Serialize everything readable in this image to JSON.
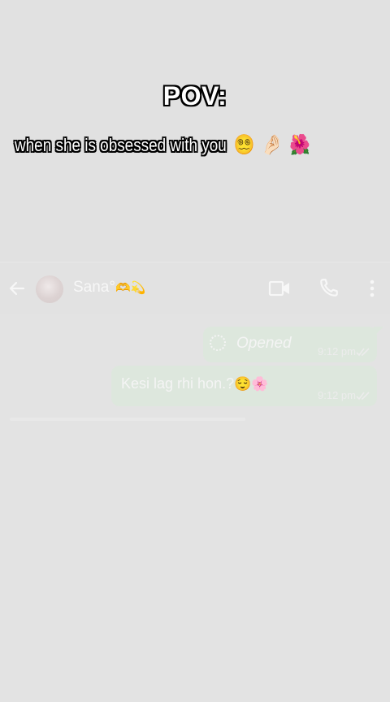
{
  "overlay": {
    "title": "POV:",
    "line_text": "when she  is obsessed with you",
    "emojis": [
      "😵‍💫",
      "🤌🏻",
      "🌺"
    ]
  },
  "header": {
    "contact_name": "Sana°",
    "name_decoration": "🫶💫",
    "icons": [
      "back-arrow-icon",
      "avatar",
      "video-call-icon",
      "voice-call-icon",
      "more-options-icon"
    ]
  },
  "messages": [
    {
      "type": "view-once",
      "text": "Opened",
      "time": "9:12 pm",
      "status": "read",
      "icon": "loading-ring-icon"
    },
    {
      "type": "text",
      "text": "Kesi lag rhi hon.?",
      "emojis": "😌🌸",
      "time": "9:12 pm",
      "status": "read"
    }
  ],
  "colors": {
    "background": "#e1e1e1",
    "bubble": "#dde7dd",
    "header_text": "#f7f7f7"
  }
}
